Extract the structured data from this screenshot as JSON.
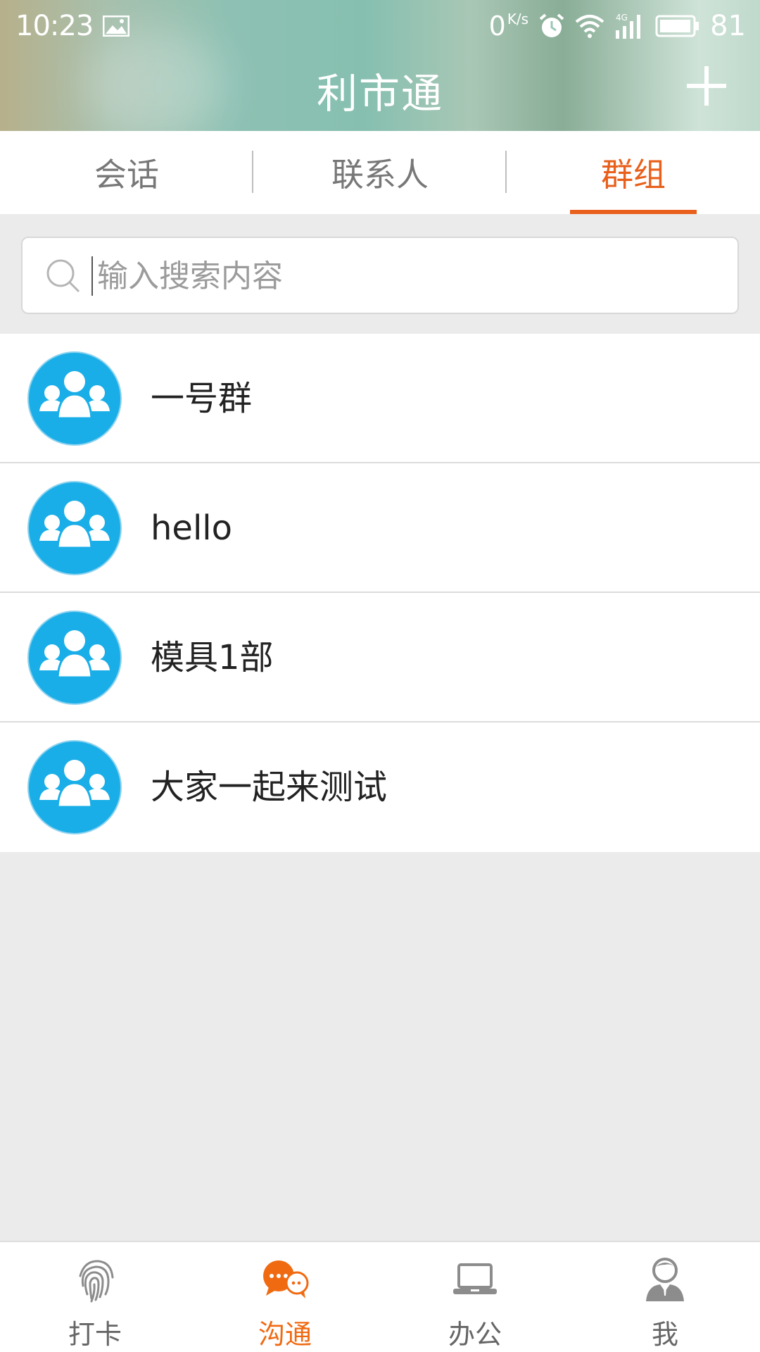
{
  "status_bar": {
    "time": "10:23",
    "net_speed": "0",
    "net_unit": "K/s",
    "battery": "81",
    "icons": [
      "image-icon",
      "alarm-icon",
      "wifi-icon",
      "signal-4g-icon",
      "battery-icon"
    ]
  },
  "header": {
    "title": "利市通",
    "add_icon": "plus-icon"
  },
  "tabs": [
    {
      "label": "会话",
      "active": false
    },
    {
      "label": "联系人",
      "active": false
    },
    {
      "label": "群组",
      "active": true
    }
  ],
  "search": {
    "placeholder": "输入搜索内容",
    "value": "",
    "icon": "search-icon"
  },
  "groups": [
    {
      "name": "一号群",
      "icon": "group-avatar-icon"
    },
    {
      "name": "hello",
      "icon": "group-avatar-icon"
    },
    {
      "name": "模具1部",
      "icon": "group-avatar-icon"
    },
    {
      "name": "大家一起来测试",
      "icon": "group-avatar-icon"
    }
  ],
  "bottom_nav": [
    {
      "label": "打卡",
      "icon": "fingerprint-icon",
      "active": false
    },
    {
      "label": "沟通",
      "icon": "chat-icon",
      "active": true
    },
    {
      "label": "办公",
      "icon": "laptop-icon",
      "active": false
    },
    {
      "label": "我",
      "icon": "person-icon",
      "active": false
    }
  ],
  "colors": {
    "accent": "#e8601c",
    "avatar_blue": "#1aaee8",
    "nav_active": "#f06a12",
    "background": "#ebebeb"
  }
}
